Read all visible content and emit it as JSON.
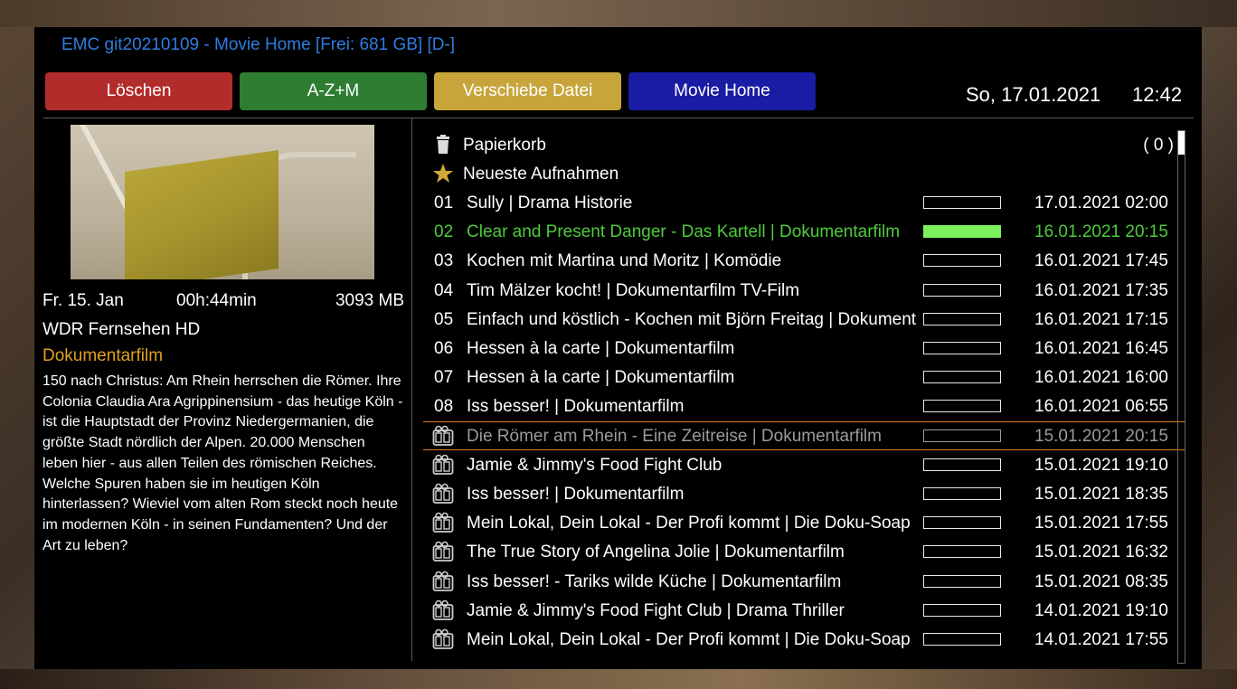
{
  "header": {
    "title": "EMC git20210109 - Movie Home [Frei: 681 GB] [D-]",
    "date": "So, 17.01.2021",
    "time": "12:42"
  },
  "buttons": {
    "red": "Löschen",
    "green": "A-Z+M",
    "yellow": "Verschiebe Datei",
    "blue": "Movie Home"
  },
  "info": {
    "date": "Fr. 15. Jan",
    "duration": "00h:44min",
    "size": "3093 MB",
    "channel": "WDR Fernsehen HD",
    "genre": "Dokumentarfilm",
    "description": "150 nach Christus: Am Rhein herrschen die Römer. Ihre Colonia Claudia Ara Agrippinensium - das heutige Köln - ist die Hauptstadt der Provinz Niedergermanien, die größte Stadt nördlich der Alpen. 20.000 Menschen leben hier - aus allen Teilen des römischen Reiches. Welche Spuren haben sie im heutigen Köln hinterlassen? Wieviel vom alten Rom steckt noch heute im modernen Köln - in seinen Fundamenten? Und der Art zu leben?"
  },
  "list": {
    "trash": {
      "label": "Papierkorb",
      "count": "( 0 )",
      "icon": "trash-icon"
    },
    "latest": {
      "label": "Neueste Aufnahmen",
      "icon": "star-icon"
    },
    "items": [
      {
        "num": "01",
        "title": "Sully | Drama Historie",
        "date": "17.01.2021 02:00",
        "progress": 0
      },
      {
        "num": "02",
        "title": "Clear and Present Danger - Das Kartell | Dokumentarfilm",
        "date": "16.01.2021 20:15",
        "progress": 1.0
      },
      {
        "num": "03",
        "title": "Kochen mit Martina und Moritz | Komödie",
        "date": "16.01.2021 17:45",
        "progress": 0
      },
      {
        "num": "04",
        "title": "Tim Mälzer kocht! | Dokumentarfilm TV-Film",
        "date": "16.01.2021 17:35",
        "progress": 0
      },
      {
        "num": "05",
        "title": "Einfach und köstlich - Kochen mit Björn Freitag | Dokument",
        "date": "16.01.2021 17:15",
        "progress": 0
      },
      {
        "num": "06",
        "title": "Hessen à la carte | Dokumentarfilm",
        "date": "16.01.2021 16:45",
        "progress": 0
      },
      {
        "num": "07",
        "title": "Hessen à la carte | Dokumentarfilm",
        "date": "16.01.2021 16:00",
        "progress": 0
      },
      {
        "num": "08",
        "title": "Iss besser! | Dokumentarfilm",
        "date": "16.01.2021 06:55",
        "progress": 0
      },
      {
        "num": "",
        "title": "Die Römer am Rhein - Eine Zeitreise | Dokumentarfilm",
        "date": "15.01.2021 20:15",
        "progress": 0
      },
      {
        "num": "",
        "title": "Jamie & Jimmy's Food Fight Club",
        "date": "15.01.2021 19:10",
        "progress": 0
      },
      {
        "num": "",
        "title": "Iss besser! | Dokumentarfilm",
        "date": "15.01.2021 18:35",
        "progress": 0
      },
      {
        "num": "",
        "title": "Mein Lokal, Dein Lokal - Der Profi kommt | Die Doku-Soap",
        "date": "15.01.2021 17:55",
        "progress": 0
      },
      {
        "num": "",
        "title": "The True Story of Angelina Jolie | Dokumentarfilm",
        "date": "15.01.2021 16:32",
        "progress": 0
      },
      {
        "num": "",
        "title": "Iss besser! - Tariks wilde Küche | Dokumentarfilm",
        "date": "15.01.2021 08:35",
        "progress": 0
      },
      {
        "num": "",
        "title": "Jamie & Jimmy's Food Fight Club | Drama Thriller",
        "date": "14.01.2021 19:10",
        "progress": 0
      },
      {
        "num": "",
        "title": "Mein Lokal, Dein Lokal - Der Profi kommt | Die Doku-Soap",
        "date": "14.01.2021 17:55",
        "progress": 0
      }
    ]
  },
  "colors": {
    "accent": "#2f7dde",
    "playing": "#4ecb3c",
    "selection": "#e07b20",
    "genre": "#e0a020"
  }
}
